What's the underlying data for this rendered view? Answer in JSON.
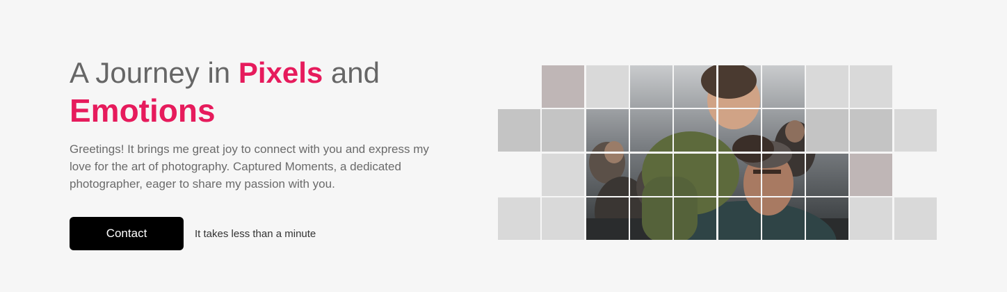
{
  "hero": {
    "title_part1": "A Journey in ",
    "title_accent": "Pixels",
    "title_part2": " and",
    "title_line2": "Emotions",
    "description": "Greetings! It brings me great joy to connect with you and express my love for the art of photography. Captured Moments, a dedicated photographer, eager to share my passion with you.",
    "contact_label": "Contact",
    "cta_note": "It takes less than a minute"
  },
  "colors": {
    "accent": "#e61b5c",
    "button": "#000000",
    "background": "#f6f6f6"
  },
  "mosaic": {
    "image_subject": "child riding on man's shoulders in a crowd"
  }
}
